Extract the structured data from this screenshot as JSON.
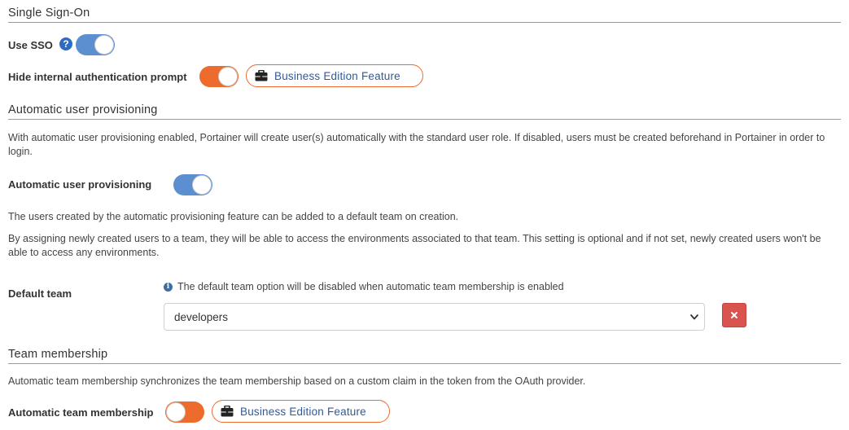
{
  "sso": {
    "section_title": "Single Sign-On",
    "use_sso_label": "Use SSO",
    "use_sso_on": true,
    "hide_prompt_label": "Hide internal authentication prompt",
    "hide_prompt_on": true,
    "be_badge_label": "Business Edition Feature"
  },
  "provisioning": {
    "section_title": "Automatic user provisioning",
    "description": "With automatic user provisioning enabled, Portainer will create user(s) automatically with the standard user role. If disabled, users must be created beforehand in Portainer in order to login.",
    "toggle_label": "Automatic user provisioning",
    "toggle_on": true,
    "default_team_note": "The users created by the automatic provisioning feature can be added to a default team on creation.",
    "team_assign_note": "By assigning newly created users to a team, they will be able to access the environments associated to that team. This setting is optional and if not set, newly created users won't be able to access any environments.",
    "default_team_label": "Default team",
    "default_team_info": "The default team option will be disabled when automatic team membership is enabled",
    "default_team_value": "developers"
  },
  "team_membership": {
    "section_title": "Team membership",
    "description": "Automatic team membership synchronizes the team membership based on a custom claim in the token from the OAuth provider.",
    "toggle_label": "Automatic team membership",
    "toggle_on": false,
    "be_badge_label": "Business Edition Feature"
  },
  "colors": {
    "toggle_blue": "#5b8fcf",
    "toggle_orange": "#ec6b2d",
    "badge_border": "#ec6b2d",
    "badge_text": "#2d5a9e",
    "remove_button": "#d9534f"
  },
  "icons": {
    "help": "question-circle-icon",
    "briefcase": "briefcase-icon",
    "info": "info-circle-icon",
    "chevron": "chevron-down-icon",
    "remove": "times-icon"
  }
}
